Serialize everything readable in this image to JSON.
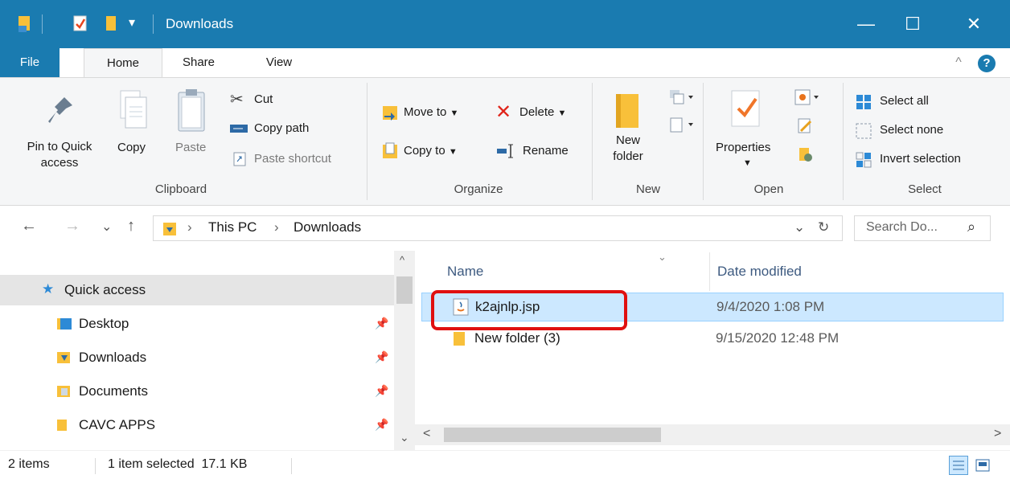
{
  "titlebar": {
    "title": "Downloads",
    "minimize": "—",
    "maximize": "☐",
    "close": "✕",
    "qat_dropdown": "▾"
  },
  "tabs": {
    "file": "File",
    "home": "Home",
    "share": "Share",
    "view": "View",
    "collapse": "^",
    "help": "?"
  },
  "ribbon": {
    "clipboard": {
      "pin_line1": "Pin to Quick",
      "pin_line2": "access",
      "copy": "Copy",
      "paste": "Paste",
      "cut": "Cut",
      "copy_path": "Copy path",
      "paste_shortcut": "Paste shortcut",
      "label": "Clipboard"
    },
    "organize": {
      "move_to": "Move to",
      "copy_to": "Copy to",
      "delete": "Delete",
      "rename": "Rename",
      "label": "Organize"
    },
    "new": {
      "new_folder_line1": "New",
      "new_folder_line2": "folder",
      "label": "New"
    },
    "open": {
      "properties": "Properties",
      "label": "Open"
    },
    "select": {
      "select_all": "Select all",
      "select_none": "Select none",
      "invert_selection": "Invert selection",
      "label": "Select"
    }
  },
  "address": {
    "back": "←",
    "forward": "→",
    "recent": "⌄",
    "up": "↑",
    "crumb_sep": "›",
    "path": [
      "This PC",
      "Downloads"
    ],
    "dropdown": "⌄",
    "refresh": "↻",
    "search_placeholder": "Search Do...",
    "search_icon": "⌕"
  },
  "nav": {
    "items": [
      {
        "label": "Quick access",
        "selected": true,
        "pinned": false
      },
      {
        "label": "Desktop",
        "pinned": true
      },
      {
        "label": "Downloads",
        "pinned": true
      },
      {
        "label": "Documents",
        "pinned": true
      },
      {
        "label": "CAVC APPS",
        "pinned": true
      }
    ],
    "scroll_up": "^",
    "scroll_down": "⌄"
  },
  "files": {
    "columns": {
      "name": "Name",
      "date": "Date modified",
      "sort_indicator": "⌄"
    },
    "rows": [
      {
        "name": "k2ajnlp.jsp",
        "date": "9/4/2020 1:08 PM",
        "selected": true,
        "icon": "java-file-icon"
      },
      {
        "name": "New folder (3)",
        "date": "9/15/2020 12:48 PM",
        "selected": false,
        "icon": "folder-icon"
      }
    ],
    "scroll_left": "<",
    "scroll_right": ">"
  },
  "status": {
    "count": "2 items",
    "selection": "1 item selected  17.1 KB"
  },
  "colors": {
    "titlebar": "#1a7bb0",
    "selection": "#cce8ff",
    "highlight": "#e01010"
  }
}
